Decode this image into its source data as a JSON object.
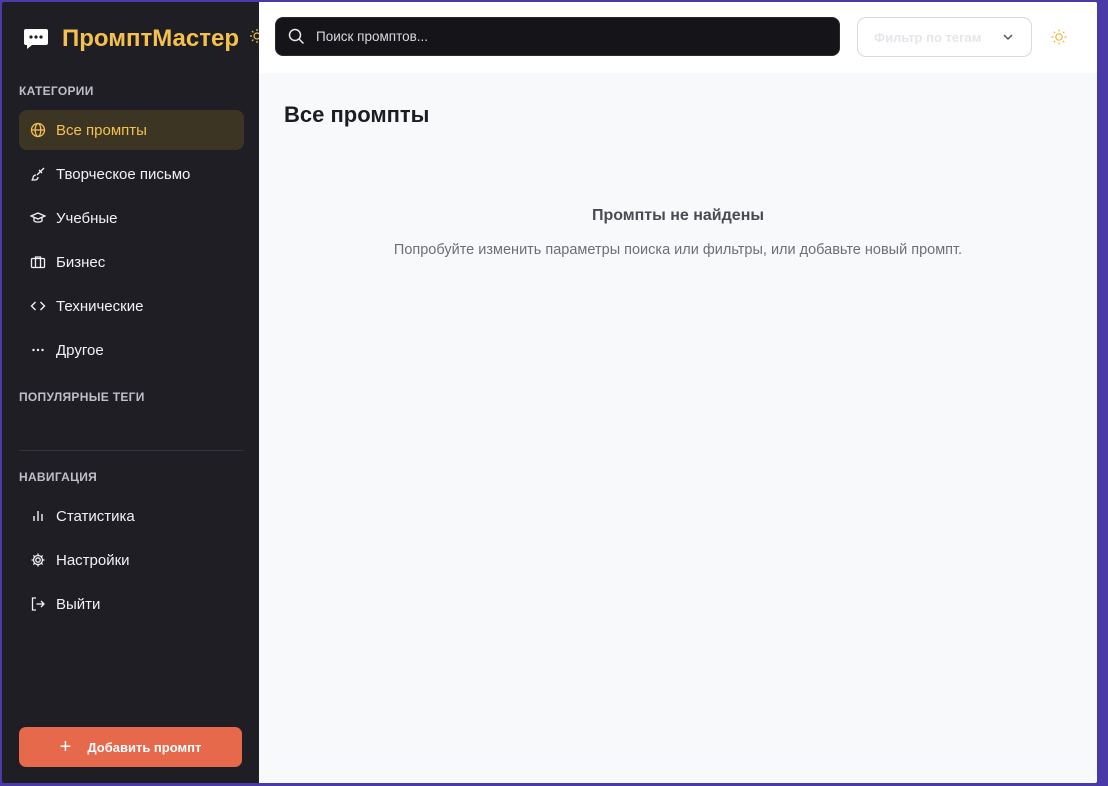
{
  "brand": {
    "title": "ПромптМастер",
    "icon": "chat-bubble-icon"
  },
  "sidebar": {
    "categories_title": "КАТЕГОРИИ",
    "categories": [
      {
        "label": "Все промпты",
        "icon": "globe-icon",
        "active": true
      },
      {
        "label": "Творческое письмо",
        "icon": "brush-icon"
      },
      {
        "label": "Учебные",
        "icon": "graduation-cap-icon"
      },
      {
        "label": "Бизнес",
        "icon": "briefcase-icon"
      },
      {
        "label": "Технические",
        "icon": "code-icon"
      },
      {
        "label": "Другое",
        "icon": "more-icon"
      }
    ],
    "tags_title": "ПОПУЛЯРНЫЕ ТЕГИ",
    "navigation_title": "НАВИГАЦИЯ",
    "navigation": [
      {
        "label": "Статистика",
        "icon": "bar-chart-icon"
      },
      {
        "label": "Настройки",
        "icon": "gear-icon"
      },
      {
        "label": "Выйти",
        "icon": "logout-icon"
      }
    ],
    "add_button": "Добавить промпт"
  },
  "header": {
    "search_placeholder": "Поиск промптов...",
    "tag_filter_label": "Фильтр по тегам"
  },
  "main": {
    "page_title": "Все промпты",
    "empty_title": "Промпты не найдены",
    "empty_text": "Попробуйте изменить параметры поиска или фильтры, или добавьте новый промпт."
  },
  "colors": {
    "accent": "#f4c14e",
    "add_button": "#e5694a",
    "sidebar_bg": "#1f1e25"
  }
}
